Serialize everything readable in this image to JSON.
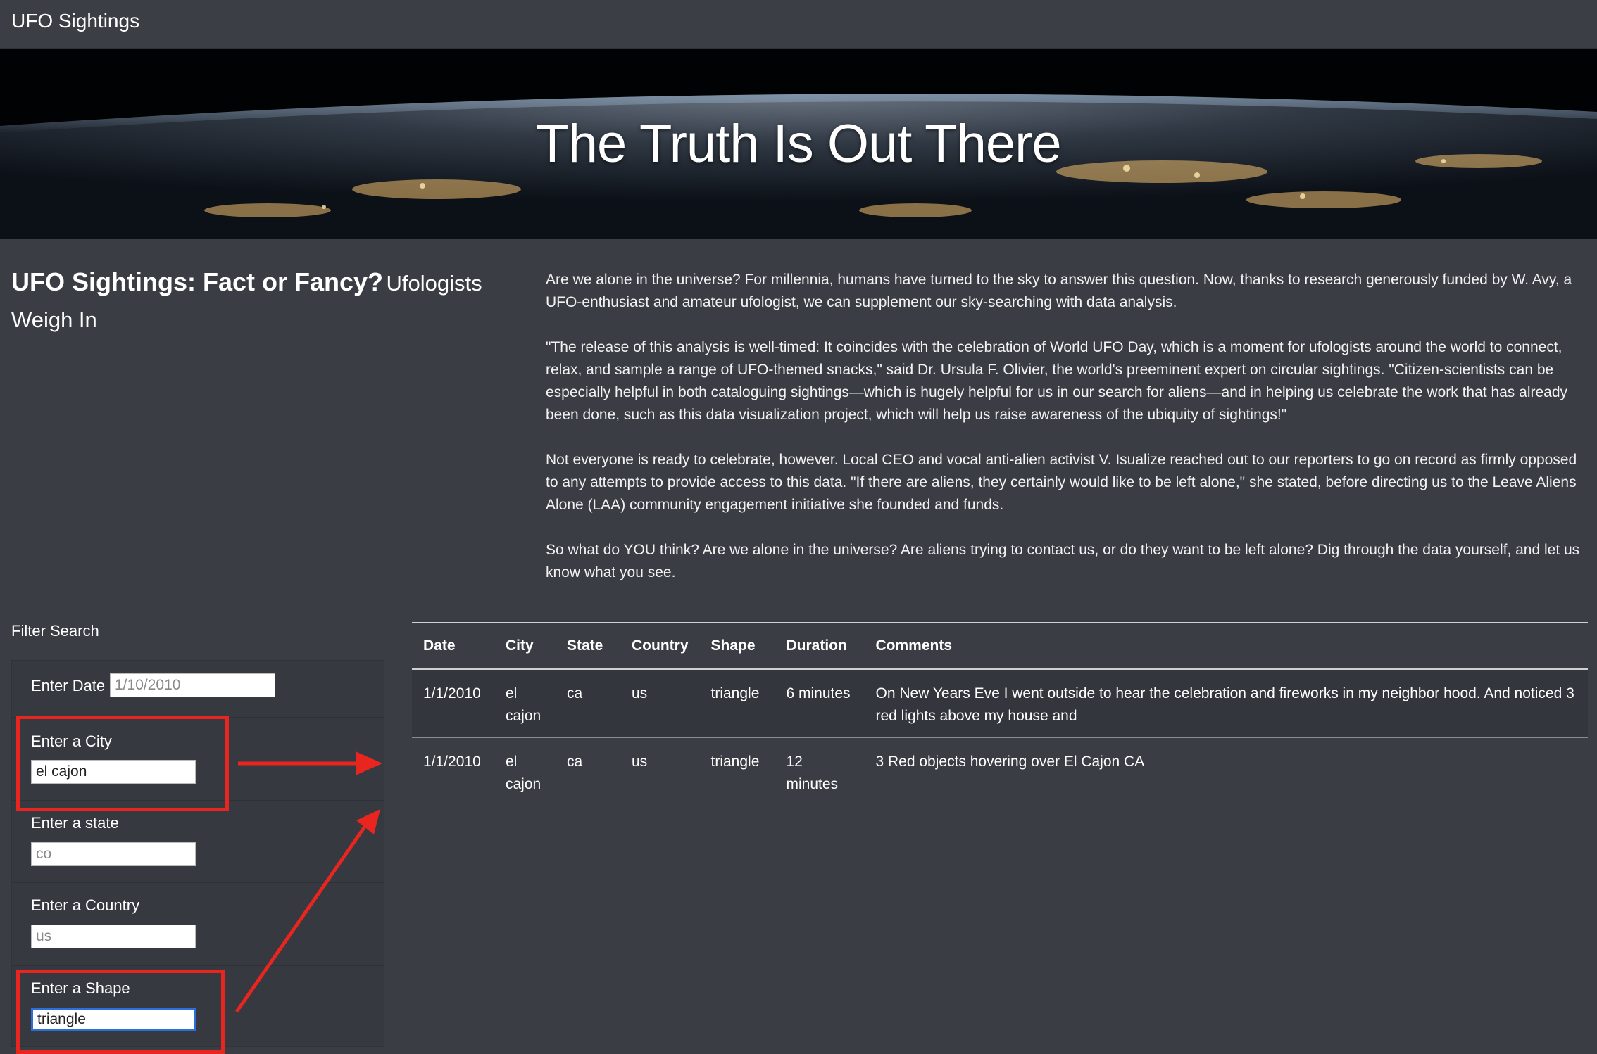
{
  "navbar": {
    "brand": "UFO Sightings"
  },
  "hero": {
    "title": "The Truth Is Out There"
  },
  "intro": {
    "title": "UFO Sightings: Fact or Fancy?",
    "subtitle": "Ufologists Weigh In"
  },
  "article": {
    "paragraphs": [
      "Are we alone in the universe? For millennia, humans have turned to the sky to answer this question. Now, thanks to research generously funded by W. Avy, a UFO-enthusiast and amateur ufologist, we can supplement our sky-searching with data analysis.",
      "\"The release of this analysis is well-timed: It coincides with the celebration of World UFO Day, which is a moment for ufologists around the world to connect, relax, and sample a range of UFO-themed snacks,\" said Dr. Ursula F. Olivier, the world's preeminent expert on circular sightings. \"Citizen-scientists can be especially helpful in both cataloguing sightings—which is hugely helpful for us in our search for aliens—and in helping us celebrate the work that has already been done, such as this data visualization project, which will help us raise awareness of the ubiquity of sightings!\"",
      "Not everyone is ready to celebrate, however. Local CEO and vocal anti-alien activist V. Isualize reached out to our reporters to go on record as firmly opposed to any attempts to provide access to this data. \"If there are aliens, they certainly would like to be left alone,\" she stated, before directing us to the Leave Aliens Alone (LAA) community engagement initiative she founded and funds.",
      "So what do YOU think? Are we alone in the universe? Are aliens trying to contact us, or do they want to be left alone? Dig through the data yourself, and let us know what you see."
    ]
  },
  "filters": {
    "heading": "Filter Search",
    "date": {
      "label": "Enter Date",
      "value": "",
      "placeholder": "1/10/2010"
    },
    "city": {
      "label": "Enter a City",
      "value": "el cajon",
      "placeholder": ""
    },
    "state": {
      "label": "Enter a state",
      "value": "",
      "placeholder": "co"
    },
    "country": {
      "label": "Enter a Country",
      "value": "",
      "placeholder": "us"
    },
    "shape": {
      "label": "Enter a Shape",
      "value": "triangle",
      "placeholder": ""
    }
  },
  "annotation": {
    "color": "#e8251e"
  },
  "table": {
    "headers": [
      "Date",
      "City",
      "State",
      "Country",
      "Shape",
      "Duration",
      "Comments"
    ],
    "rows": [
      [
        "1/1/2010",
        "el cajon",
        "ca",
        "us",
        "triangle",
        "6 minutes",
        "On New Years Eve I went outside to hear the celebration and fireworks in my neighbor hood. And noticed 3 red lights above my house and"
      ],
      [
        "1/1/2010",
        "el cajon",
        "ca",
        "us",
        "triangle",
        "12 minutes",
        "3 Red objects hovering over El Cajon CA"
      ]
    ]
  }
}
